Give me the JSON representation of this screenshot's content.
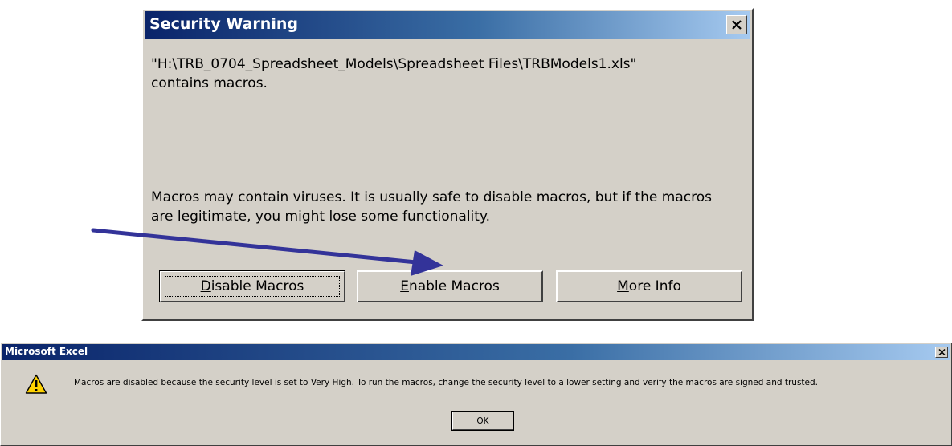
{
  "security_dialog": {
    "title": "Security Warning",
    "message_line1": "\"H:\\TRB_0704_Spreadsheet_Models\\Spreadsheet Files\\TRBModels1.xls\"",
    "message_line2": "contains macros.",
    "warning_text": "Macros may contain viruses. It is usually safe to disable macros, but if the macros are legitimate, you might lose some functionality.",
    "buttons": {
      "disable": {
        "accel": "D",
        "rest": "isable Macros"
      },
      "enable": {
        "accel": "E",
        "rest": "nable Macros"
      },
      "more_info": {
        "accel": "M",
        "rest": "ore Info"
      }
    }
  },
  "excel_dialog": {
    "title": "Microsoft Excel",
    "message": "Macros are disabled because the security level is set to Very High. To run the macros, change the security level to a lower setting and verify the macros are signed and trusted.",
    "ok_label": "OK"
  },
  "colors": {
    "dialog_face": "#d4d0c8",
    "titlebar_start": "#0a246a",
    "titlebar_end": "#a6caf0",
    "arrow": "#333399"
  },
  "icons": {
    "close": "close-icon",
    "warning": "warning-icon"
  }
}
